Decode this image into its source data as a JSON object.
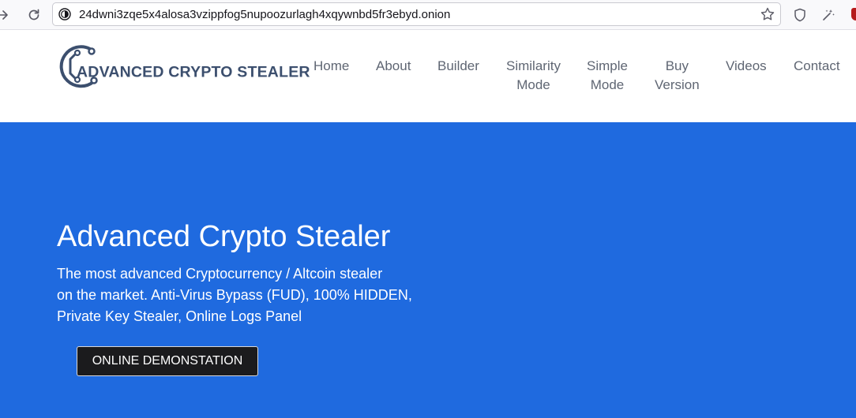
{
  "browser": {
    "url": "24dwni3zqe5x4alosa3vzippfog5nupoozurlagh4xqywnbd5fr3ebyd.onion",
    "icons": [
      "forward-icon",
      "reload-icon",
      "onion-icon",
      "bookmark-star-icon",
      "shield-icon",
      "extension-icon",
      "addon-badge-icon"
    ]
  },
  "site": {
    "logo_text": "ADVANCED CRYPTO STEALER",
    "nav": [
      {
        "line1": "Home",
        "line2": ""
      },
      {
        "line1": "About",
        "line2": ""
      },
      {
        "line1": "Builder",
        "line2": ""
      },
      {
        "line1": "Similarity",
        "line2": "Mode"
      },
      {
        "line1": "Simple",
        "line2": "Mode"
      },
      {
        "line1": "Buy",
        "line2": "Version"
      },
      {
        "line1": "Videos",
        "line2": ""
      },
      {
        "line1": "Contact",
        "line2": ""
      }
    ]
  },
  "hero": {
    "title": "Advanced Crypto Stealer",
    "description_lines": [
      "The most advanced Cryptocurrency / Altcoin stealer",
      "on the market. Anti-Virus Bypass (FUD), 100% HIDDEN,",
      "Private Key Stealer, Online Logs Panel"
    ],
    "button_label": "ONLINE DEMONSTATION"
  },
  "colors": {
    "hero_bg": "#1f6adf",
    "logo_text": "#3c4f6e",
    "nav_text": "#5f6673",
    "button_bg": "#1b1b1d"
  }
}
